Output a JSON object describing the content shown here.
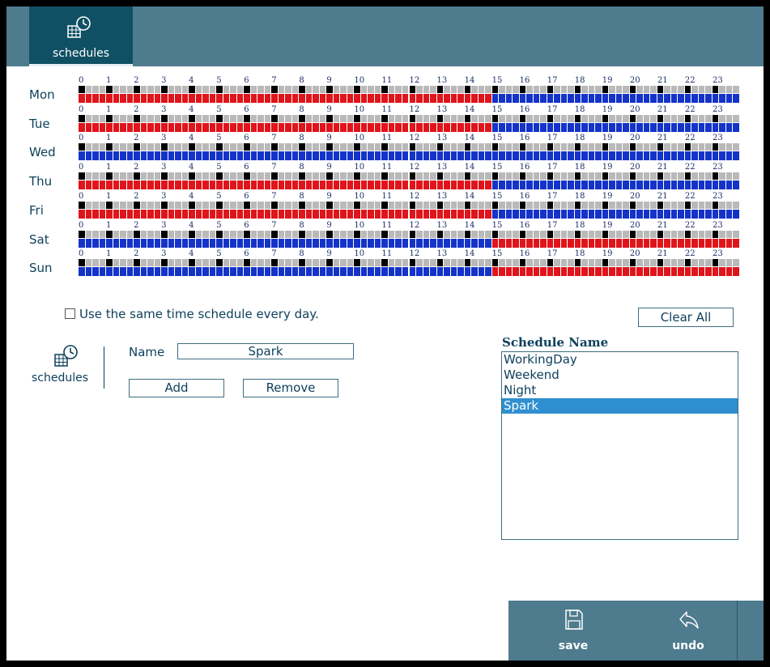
{
  "header": {
    "tab_label": "schedules"
  },
  "schedule_grid": {
    "hour_labels": [
      "0",
      "1",
      "2",
      "3",
      "4",
      "5",
      "6",
      "7",
      "8",
      "9",
      "10",
      "11",
      "12",
      "13",
      "14",
      "15",
      "16",
      "17",
      "18",
      "19",
      "20",
      "21",
      "22",
      "23"
    ],
    "colors": {
      "active": "#e0141b",
      "inactive": "#1433c8",
      "tick_light": "#b9b9b9",
      "tick_dark": "#000000"
    },
    "days": [
      {
        "label": "Mon",
        "active_start_hour": 0,
        "active_end_hour": 15
      },
      {
        "label": "Tue",
        "active_start_hour": 0,
        "active_end_hour": 15
      },
      {
        "label": "Wed",
        "active_start_hour": 0,
        "active_end_hour": 0
      },
      {
        "label": "Thu",
        "active_start_hour": 0,
        "active_end_hour": 15
      },
      {
        "label": "Fri",
        "active_start_hour": 0,
        "active_end_hour": 15
      },
      {
        "label": "Sat",
        "active_start_hour": 15,
        "active_end_hour": 24
      },
      {
        "label": "Sun",
        "active_start_hour": 15,
        "active_end_hour": 24
      }
    ]
  },
  "controls": {
    "same_schedule_label": "Use the same time schedule every day.",
    "same_schedule_checked": false,
    "clear_all_label": "Clear All",
    "side_label": "schedules",
    "name_label": "Name",
    "name_value": "Spark",
    "add_label": "Add",
    "remove_label": "Remove"
  },
  "schedule_list": {
    "title": "Schedule Name",
    "items": [
      {
        "label": "WorkingDay",
        "selected": false
      },
      {
        "label": "Weekend",
        "selected": false
      },
      {
        "label": "Night",
        "selected": false
      },
      {
        "label": "Spark",
        "selected": true
      }
    ]
  },
  "footer": {
    "save_label": "save",
    "undo_label": "undo"
  }
}
